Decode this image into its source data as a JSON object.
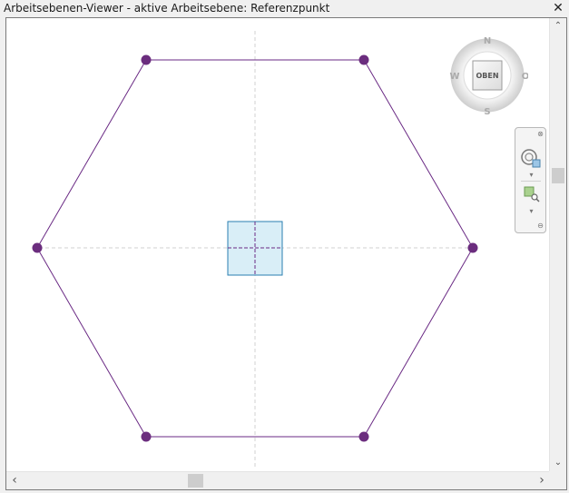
{
  "window": {
    "title": "Arbeitsebenen-Viewer - aktive Arbeitsebene: Referenzpunkt",
    "close_glyph": "✕"
  },
  "viewcube": {
    "face_label": "OBEN",
    "north": "N",
    "south": "S",
    "east": "O",
    "west": "W"
  },
  "navigation_bar": {
    "tools": [
      "steering-wheel-icon",
      "zoom-region-icon"
    ]
  },
  "scrollbars": {
    "up_glyph": "⌃",
    "down_glyph": "⌄",
    "left_glyph": "‹",
    "right_glyph": "›"
  },
  "colors": {
    "hexagon": "#6a2a84",
    "vertex": "#6b2d7e",
    "reference_fill": "#d9eef7",
    "reference_stroke": "#2a7fb0",
    "guides": "#d0d0d0"
  }
}
